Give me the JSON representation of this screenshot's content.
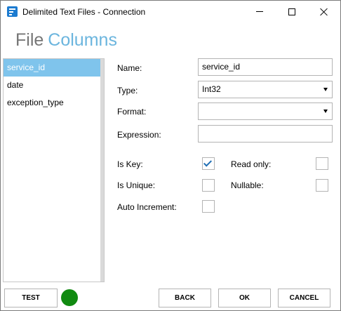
{
  "window": {
    "title": "Delimited Text Files - Connection",
    "icon": "app-icon"
  },
  "heading": {
    "part1": "File",
    "part2": "Columns"
  },
  "columns": [
    {
      "name": "service_id",
      "selected": true
    },
    {
      "name": "date",
      "selected": false
    },
    {
      "name": "exception_type",
      "selected": false
    }
  ],
  "form": {
    "name_label": "Name:",
    "name_value": "service_id",
    "type_label": "Type:",
    "type_value": "Int32",
    "format_label": "Format:",
    "format_value": "",
    "expression_label": "Expression:",
    "expression_value": "",
    "is_key_label": "Is Key:",
    "is_key": true,
    "read_only_label": "Read only:",
    "read_only": false,
    "is_unique_label": "Is Unique:",
    "is_unique": false,
    "nullable_label": "Nullable:",
    "nullable": false,
    "auto_increment_label": "Auto Increment:",
    "auto_increment": false
  },
  "footer": {
    "test_label": "TEST",
    "back_label": "BACK",
    "ok_label": "OK",
    "cancel_label": "CANCEL",
    "status_color": "#118a11"
  },
  "colors": {
    "accent": "#6bb5de",
    "selection": "#7fc4ec",
    "checkmark": "#1f6eb4"
  }
}
